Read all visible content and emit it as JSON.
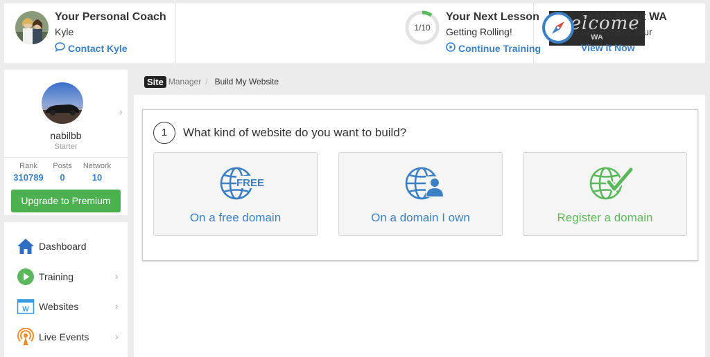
{
  "coach": {
    "title": "Your Personal Coach",
    "name": "Kyle",
    "contact_label": "Contact Kyle"
  },
  "lesson": {
    "title": "Your Next Lesson",
    "subtitle": "Getting Rolling!",
    "progress_text": "1/10",
    "progress_fraction": 0.1,
    "continue_label": "Continue Training",
    "banner_text": "welcome",
    "banner_logo": "WA"
  },
  "learn": {
    "title": "Learn About WA",
    "subtitle": "WA System Tour",
    "link_label": "View it Now"
  },
  "profile": {
    "username": "nabilbb",
    "level": "Starter",
    "stats": [
      {
        "label": "Rank",
        "value": "310789"
      },
      {
        "label": "Posts",
        "value": "0"
      },
      {
        "label": "Network",
        "value": "10"
      }
    ],
    "upgrade_label": "Upgrade to Premium"
  },
  "nav": {
    "items": [
      {
        "label": "Dashboard",
        "icon": "home-icon"
      },
      {
        "label": "Training",
        "icon": "play-icon"
      },
      {
        "label": "Websites",
        "icon": "websites-icon"
      },
      {
        "label": "Live Events",
        "icon": "broadcast-icon"
      }
    ]
  },
  "breadcrumb": {
    "site": "Site",
    "manager": "Manager",
    "separator": "/",
    "current": "Build My Website"
  },
  "builder": {
    "step": "1",
    "question": "What kind of website do you want to build?",
    "options": [
      {
        "label": "On a free domain",
        "icon": "globe-free-icon",
        "badge": "FREE"
      },
      {
        "label": "On a domain I own",
        "icon": "globe-user-icon"
      },
      {
        "label": "Register a domain",
        "icon": "globe-check-icon"
      }
    ]
  },
  "colors": {
    "accent_blue": "#3b7fc4",
    "accent_green": "#4caf50",
    "option_green": "#5cb85c"
  }
}
